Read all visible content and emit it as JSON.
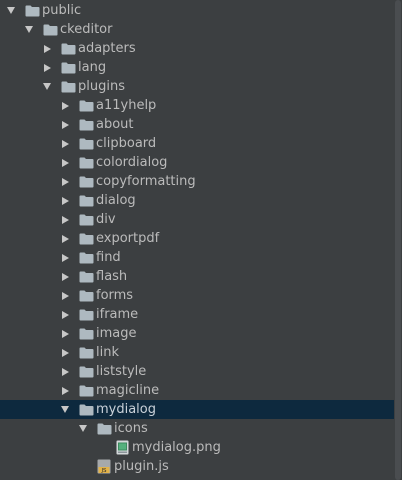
{
  "colors": {
    "background": "#3c3f41",
    "text": "#bbbbbb",
    "selection": "#0d293e",
    "folder": "#aeb9c0",
    "arrow": "#c7c7c7"
  },
  "tree": [
    {
      "label": "public",
      "depth": 0,
      "arrow": "expanded",
      "icon": "folder-icon"
    },
    {
      "label": "ckeditor",
      "depth": 1,
      "arrow": "expanded",
      "icon": "folder-icon"
    },
    {
      "label": "adapters",
      "depth": 2,
      "arrow": "collapsed",
      "icon": "folder-icon"
    },
    {
      "label": "lang",
      "depth": 2,
      "arrow": "collapsed",
      "icon": "folder-icon"
    },
    {
      "label": "plugins",
      "depth": 2,
      "arrow": "expanded",
      "icon": "folder-icon"
    },
    {
      "label": "a11yhelp",
      "depth": 3,
      "arrow": "collapsed",
      "icon": "folder-icon"
    },
    {
      "label": "about",
      "depth": 3,
      "arrow": "collapsed",
      "icon": "folder-icon"
    },
    {
      "label": "clipboard",
      "depth": 3,
      "arrow": "collapsed",
      "icon": "folder-icon"
    },
    {
      "label": "colordialog",
      "depth": 3,
      "arrow": "collapsed",
      "icon": "folder-icon"
    },
    {
      "label": "copyformatting",
      "depth": 3,
      "arrow": "collapsed",
      "icon": "folder-icon"
    },
    {
      "label": "dialog",
      "depth": 3,
      "arrow": "collapsed",
      "icon": "folder-icon"
    },
    {
      "label": "div",
      "depth": 3,
      "arrow": "collapsed",
      "icon": "folder-icon"
    },
    {
      "label": "exportpdf",
      "depth": 3,
      "arrow": "collapsed",
      "icon": "folder-icon"
    },
    {
      "label": "find",
      "depth": 3,
      "arrow": "collapsed",
      "icon": "folder-icon"
    },
    {
      "label": "flash",
      "depth": 3,
      "arrow": "collapsed",
      "icon": "folder-icon"
    },
    {
      "label": "forms",
      "depth": 3,
      "arrow": "collapsed",
      "icon": "folder-icon"
    },
    {
      "label": "iframe",
      "depth": 3,
      "arrow": "collapsed",
      "icon": "folder-icon"
    },
    {
      "label": "image",
      "depth": 3,
      "arrow": "collapsed",
      "icon": "folder-icon"
    },
    {
      "label": "link",
      "depth": 3,
      "arrow": "collapsed",
      "icon": "folder-icon"
    },
    {
      "label": "liststyle",
      "depth": 3,
      "arrow": "collapsed",
      "icon": "folder-icon"
    },
    {
      "label": "magicline",
      "depth": 3,
      "arrow": "collapsed",
      "icon": "folder-icon"
    },
    {
      "label": "mydialog",
      "depth": 3,
      "arrow": "expanded",
      "icon": "folder-icon",
      "selected": true
    },
    {
      "label": "icons",
      "depth": 4,
      "arrow": "expanded",
      "icon": "folder-icon"
    },
    {
      "label": "mydialog.png",
      "depth": 5,
      "arrow": "none",
      "icon": "image-file-icon"
    },
    {
      "label": "plugin.js",
      "depth": 4,
      "arrow": "none",
      "icon": "js-file-icon"
    }
  ]
}
